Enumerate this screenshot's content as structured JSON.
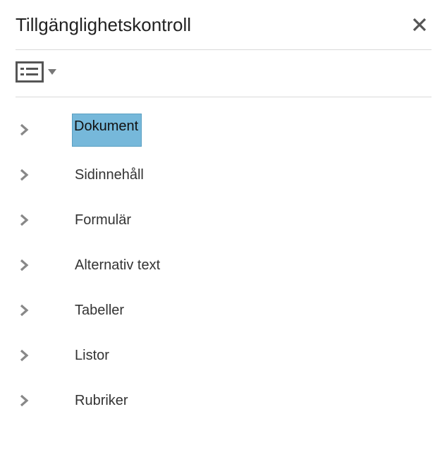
{
  "panel": {
    "title": "Tillgänglighetskontroll"
  },
  "tree": {
    "items": [
      {
        "label": "Dokument",
        "selected": true
      },
      {
        "label": "Sidinnehåll",
        "selected": false
      },
      {
        "label": "Formulär",
        "selected": false
      },
      {
        "label": "Alternativ text",
        "selected": false
      },
      {
        "label": "Tabeller",
        "selected": false
      },
      {
        "label": "Listor",
        "selected": false
      },
      {
        "label": "Rubriker",
        "selected": false
      }
    ]
  }
}
